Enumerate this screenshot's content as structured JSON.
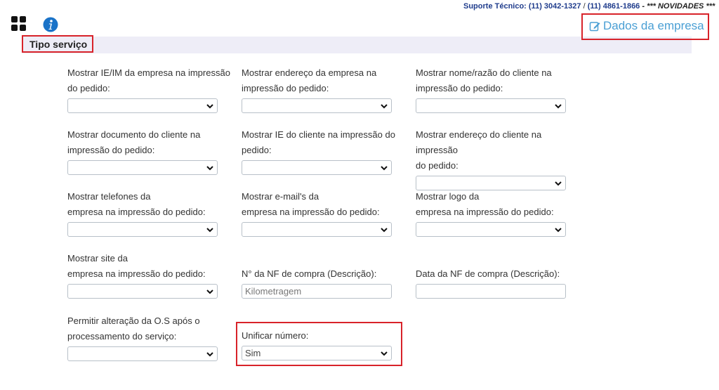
{
  "header": {
    "support_label": "Suporte Técnico: (11) 3042-1327",
    "support_sep": " / ",
    "support_phone2": "(11) 4861-1866",
    "news_text": " - *** NOVIDADES ***",
    "title": "Tipo serviço",
    "company_link": "Dados da empresa"
  },
  "icons": {
    "apps": "grid-icon",
    "info": "info-icon",
    "edit": "edit-icon"
  },
  "colors": {
    "highlight": "#d8232a",
    "link": "#4a9fd4",
    "support": "#1f3c8c",
    "header_bar": "#eeedf7"
  },
  "fields": {
    "ie_im_empresa": {
      "line1": "Mostrar IE/IM da empresa na impressão",
      "line2": "do pedido:",
      "value": ""
    },
    "endereco_empresa": {
      "line1": "Mostrar endereço da empresa na",
      "line2": "impressão do pedido:",
      "value": ""
    },
    "nome_cliente": {
      "line1": "Mostrar nome/razão do cliente na",
      "line2": "impressão do pedido:",
      "value": ""
    },
    "documento_cliente": {
      "line1": "Mostrar documento do cliente na",
      "line2": "impressão do pedido:",
      "value": ""
    },
    "ie_cliente": {
      "line1": "Mostrar IE do cliente na impressão do",
      "line2": "pedido:",
      "value": ""
    },
    "endereco_cliente": {
      "line1": "Mostrar endereço do cliente na impressão",
      "line2": "do pedido:",
      "value": ""
    },
    "telefones_empresa": {
      "line1": "Mostrar telefones da",
      "line2": "empresa na impressão do pedido:",
      "value": ""
    },
    "emails_empresa": {
      "line1": "Mostrar e-mail's da",
      "line2": "empresa na impressão do pedido:",
      "value": ""
    },
    "logo_empresa": {
      "line1": "Mostrar logo da",
      "line2": "empresa na impressão do pedido:",
      "value": ""
    },
    "site_empresa": {
      "line1": "Mostrar site da",
      "line2": "empresa na impressão do pedido:",
      "value": ""
    },
    "nf_compra_numero": {
      "line1": "N° da NF de compra (Descrição):",
      "value": "Kilometragem"
    },
    "nf_compra_data": {
      "line1": "Data da NF de compra (Descrição):",
      "value": ""
    },
    "alteracao_os": {
      "line1": "Permitir alteração da O.S após o",
      "line2": "processamento do serviço:",
      "value": ""
    },
    "unificar_numero": {
      "line1": "Unificar número:",
      "value": "Sim"
    }
  }
}
